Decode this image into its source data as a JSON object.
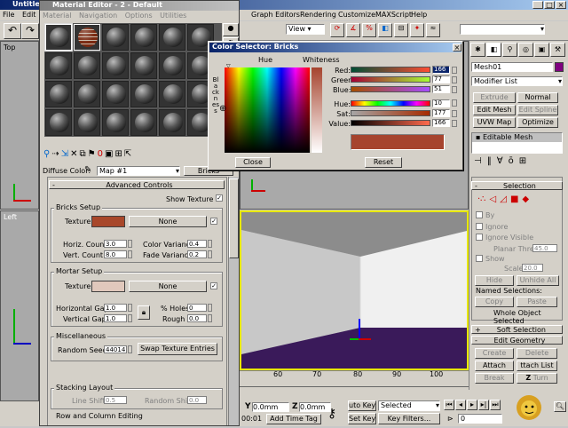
{
  "main_title": "Untitle",
  "main_title_tail": "x",
  "main_menu": [
    "File",
    "Edit"
  ],
  "main_menu2": [
    "Graph Editors",
    "Rendering",
    "Customize",
    "MAXScript",
    "Help"
  ],
  "view_dropdown": "View",
  "viewports": {
    "top": "Top",
    "left": "Left"
  },
  "mat_editor": {
    "title": "Material Editor - 2 - Default",
    "menu": [
      "Material",
      "Navigation",
      "Options",
      "Utilities"
    ],
    "diffuse_label": "Diffuse Color:",
    "map_name": "Map #1",
    "type_button": "Bricks",
    "advanced_controls": "Advanced Controls",
    "show_texture": "Show Texture",
    "bricks_setup": "Bricks Setup",
    "texture_label": "Texture :",
    "none_label": "None",
    "horiz_count_label": "Horiz. Count :",
    "horiz_count": "3.0",
    "vert_count_label": "Vert. Count :",
    "vert_count": "8.0",
    "color_var_label": "Color Variance :",
    "color_var": "0.4",
    "fade_var_label": "Fade Variance :",
    "fade_var": "0.2",
    "mortar_setup": "Mortar Setup",
    "horizontal_gap_label": "Horizontal Gap :",
    "horizontal_gap": "1.0",
    "vertical_gap_label": "Vertical Gap :",
    "vertical_gap": "1.0",
    "holes_label": "% Holes :",
    "holes": "0",
    "rough_label": "Rough :",
    "rough": "0.0",
    "misc": "Miscellaneous",
    "random_seed_label": "Random Seed :",
    "random_seed": "44014",
    "swap_button": "Swap Texture Entries",
    "stacking": "Stacking Layout",
    "line_shift_label": "Line Shift :",
    "line_shift": "0.5",
    "random_shift_label": "Random Shift :",
    "random_shift": "0.0",
    "row_column": "Row and Column Editing",
    "brick_color": "#a8472a",
    "mortar_color": "#e0c8bc"
  },
  "color_selector": {
    "title": "Color Selector: Bricks",
    "hue_label": "Hue",
    "whiteness_label": "Whiteness",
    "blackness_label": "Blackness",
    "red_label": "Red:",
    "red": "166",
    "green_label": "Green:",
    "green": "77",
    "blue_label": "Blue:",
    "blue": "51",
    "hue2_label": "Hue:",
    "hue": "10",
    "sat_label": "Sat:",
    "sat": "177",
    "value_label": "Value:",
    "value": "166",
    "close_button": "Close",
    "reset_button": "Reset",
    "swatch": "#a6442e"
  },
  "cmd_panel": {
    "object_name": "Mesh01",
    "modifier_list": "Modifier List",
    "extrude": "Extrude",
    "normal": "Normal",
    "edit_mesh": "Edit Mesh",
    "edit_spline": "Edit Spline",
    "uvw_map": "UVW Map",
    "optimize": "Optimize",
    "stack_item": "Editable Mesh",
    "selection_title": "Selection",
    "by": "By",
    "ignore": "Ignore",
    "ignore_visible": "Ignore Visible",
    "planar_thresh": "Planar Thresh",
    "planar_value": "45.0",
    "show": "Show",
    "scale_label": "Scale",
    "scale_value": "20.0",
    "hide": "Hide",
    "unhide_all": "Unhide All",
    "named_selections": "Named Selections:",
    "copy": "Copy",
    "paste": "Paste",
    "whole_object": "Whole Object Selected",
    "soft_selection": "Soft Selection",
    "edit_geometry": "Edit Geometry",
    "create": "Create",
    "delete": "Delete",
    "attach": "Attach",
    "attach_list": "ttach List",
    "break": "Break",
    "turn": "Turn"
  },
  "bottom": {
    "x_val": "0.0mm",
    "z_val": "0.0mm",
    "time": "00:01",
    "add_time_tag": "Add Time Tag",
    "auto_key": "uto Key",
    "set_key": "Set Key",
    "selected": "Selected",
    "key_filters": "Key Filters...",
    "frame": "0",
    "ticks": [
      "60",
      "70",
      "80",
      "90",
      "100"
    ],
    "timeline_ticks": [
      "80",
      "90",
      "100"
    ]
  }
}
